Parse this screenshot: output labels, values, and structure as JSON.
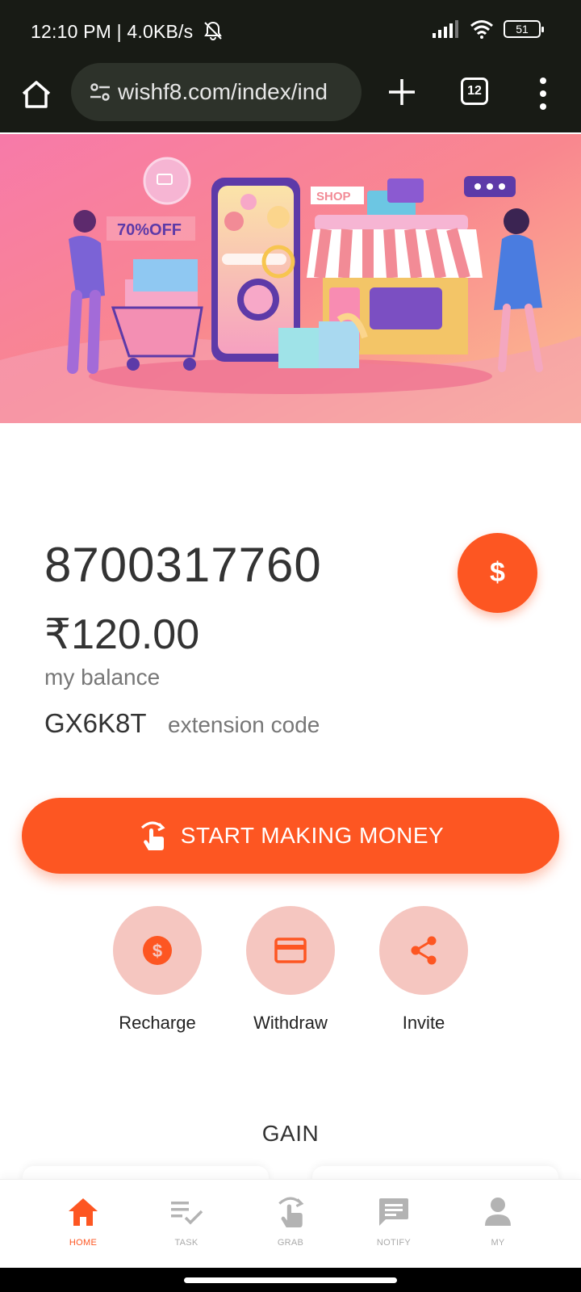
{
  "status_bar": {
    "time_speed": "12:10 PM | 4.0KB/s",
    "battery": "51",
    "icons": [
      "mute-bell-icon",
      "signal-icon",
      "wifi-icon",
      "battery-icon"
    ]
  },
  "browser": {
    "url": "wishf8.com/index/ind",
    "tab_count": "12",
    "icons": [
      "home-icon",
      "site-settings-icon",
      "plus-icon",
      "tabs-icon",
      "overflow-menu-icon"
    ]
  },
  "banner": {
    "discount_tag": "70%OFF",
    "shop_sign": "SHOP"
  },
  "account": {
    "phone": "8700317760",
    "balance": "₹120.00",
    "balance_label": "my balance",
    "extension_code": "GX6K8T",
    "extension_label": "extension code",
    "dollar_symbol": "$"
  },
  "start_button": {
    "label": "START MAKING MONEY",
    "icon": "tap-hand-icon"
  },
  "actions": [
    {
      "label": "Recharge",
      "icon": "dollar-circle-icon"
    },
    {
      "label": "Withdraw",
      "icon": "credit-card-icon"
    },
    {
      "label": "Invite",
      "icon": "share-icon"
    }
  ],
  "gain_title": "GAIN",
  "bottom_nav": [
    {
      "label": "HOME",
      "icon": "home-icon",
      "active": true
    },
    {
      "label": "TASK",
      "icon": "task-list-icon",
      "active": false
    },
    {
      "label": "GRAB",
      "icon": "tap-hand-icon",
      "active": false
    },
    {
      "label": "NOTIFY",
      "icon": "message-icon",
      "active": false
    },
    {
      "label": "MY",
      "icon": "person-icon",
      "active": false
    }
  ],
  "colors": {
    "accent": "#fd5622",
    "action_circle": "#f5c6c0",
    "status_bar_bg": "#181b15"
  }
}
